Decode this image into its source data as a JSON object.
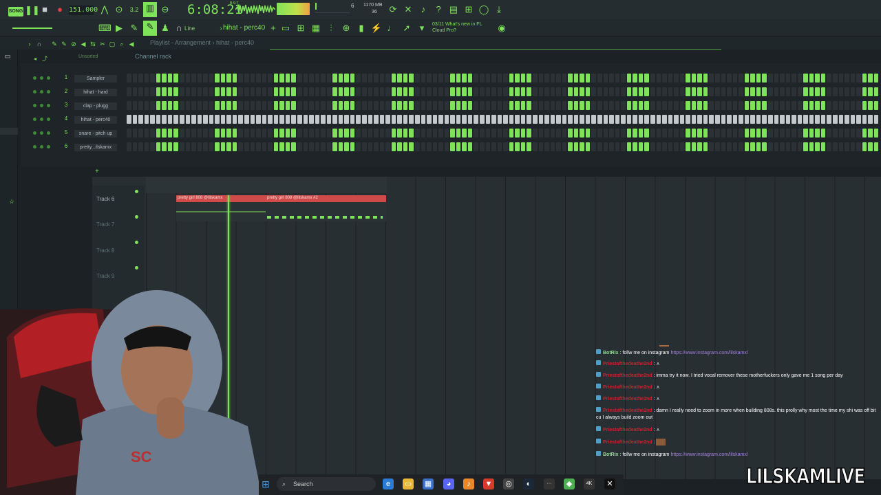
{
  "toolbar": {
    "mode_label": "SONG",
    "tempo": "151.000",
    "song_time": "6:08:21",
    "time_sub": "B:S:T",
    "cpu": "6",
    "ram": "1170 MB",
    "polyphony": "36",
    "snap_label": "Line",
    "pattern_label": "hihat - perc40",
    "news_date": "03/11",
    "news_text": "What's new in FL Cloud Pro?"
  },
  "playlist": {
    "title": "Playlist - Arrangement › hihat - perc40",
    "tracks": [
      {
        "name": "Track 6",
        "active": true
      },
      {
        "name": "Track 7",
        "active": false
      },
      {
        "name": "Track 8",
        "active": false
      },
      {
        "name": "Track 9",
        "active": false
      }
    ],
    "clips": [
      {
        "label": "pretty girl 808 @lilskamx"
      },
      {
        "label": "pretty girl 808 @lilskamx #2"
      }
    ]
  },
  "browser": {
    "unsorted": "Unsorted"
  },
  "channel_rack": {
    "title": "Channel rack",
    "channels": [
      {
        "num": "1",
        "name": "Sampler",
        "pattern": "groups"
      },
      {
        "num": "2",
        "name": "hihat - hard",
        "pattern": "groups"
      },
      {
        "num": "3",
        "name": "clap - plugg",
        "pattern": "groups"
      },
      {
        "num": "4",
        "name": "hihat - perc40",
        "pattern": "all"
      },
      {
        "num": "5",
        "name": "snare - pitch up",
        "pattern": "groups"
      },
      {
        "num": "6",
        "name": "pretty...ilskamx",
        "pattern": "groups"
      }
    ]
  },
  "chat": {
    "messages": [
      {
        "user": "BotRix",
        "text": "follw me on instagram ",
        "link": "https://www.instagram.com/lilskamx/",
        "bot": true
      },
      {
        "user": "Priestofthedeathe2nd",
        "text": "",
        "link": "",
        "bot": false
      },
      {
        "user": "Priestofthedeathe2nd",
        "text": "imma try it now. I tried vocal remover these motherfuckers only gave me 1 song per day",
        "link": "",
        "bot": false
      },
      {
        "user": "Priestofthedeathe2nd",
        "text": "",
        "link": "",
        "bot": false
      },
      {
        "user": "Priestofthedeathe2nd",
        "text": "",
        "link": "",
        "bot": false
      },
      {
        "user": "Priestofthedeathe2nd",
        "text": "damn I really need to zoom in more when building 808s. this prolly why most the time my shi was off bit cu I always build zoom out",
        "link": "",
        "bot": false
      },
      {
        "user": "Priestofthedeathe2nd",
        "text": "",
        "link": "",
        "bot": false
      },
      {
        "user": "Priestofthedeathe2nd",
        "text": "",
        "link": "",
        "bot": false
      },
      {
        "user": "BotRix",
        "text": "follw me on instagram ",
        "link": "https://www.instagram.com/lilskamx/",
        "bot": true
      }
    ]
  },
  "taskbar": {
    "search_placeholder": "Search"
  },
  "watermark": "LILSKAMLIVE"
}
